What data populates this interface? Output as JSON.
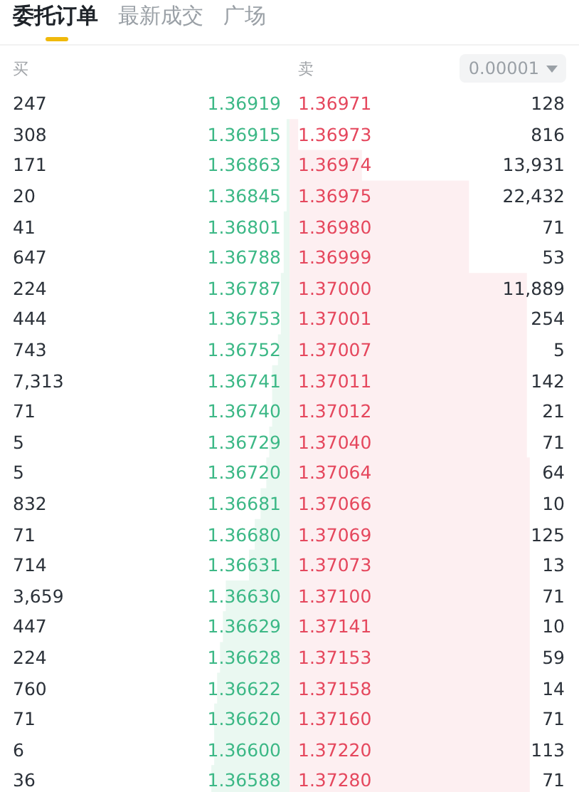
{
  "tabs": [
    {
      "label": "委托订单",
      "selected": true
    },
    {
      "label": "最新成交",
      "selected": false
    },
    {
      "label": "广场",
      "selected": false
    }
  ],
  "header": {
    "buy": "买",
    "sell": "卖",
    "precision": "0.00001"
  },
  "rows": [
    {
      "bid": {
        "qty": "247",
        "price": "1.36919"
      },
      "ask": {
        "price": "1.36971",
        "qty": "128"
      }
    },
    {
      "bid": {
        "qty": "308",
        "price": "1.36915"
      },
      "ask": {
        "price": "1.36973",
        "qty": "816"
      }
    },
    {
      "bid": {
        "qty": "171",
        "price": "1.36863"
      },
      "ask": {
        "price": "1.36974",
        "qty": "13,931"
      }
    },
    {
      "bid": {
        "qty": "20",
        "price": "1.36845"
      },
      "ask": {
        "price": "1.36975",
        "qty": "22,432"
      }
    },
    {
      "bid": {
        "qty": "41",
        "price": "1.36801"
      },
      "ask": {
        "price": "1.36980",
        "qty": "71"
      }
    },
    {
      "bid": {
        "qty": "647",
        "price": "1.36788"
      },
      "ask": {
        "price": "1.36999",
        "qty": "53"
      }
    },
    {
      "bid": {
        "qty": "224",
        "price": "1.36787"
      },
      "ask": {
        "price": "1.37000",
        "qty": "11,889"
      }
    },
    {
      "bid": {
        "qty": "444",
        "price": "1.36753"
      },
      "ask": {
        "price": "1.37001",
        "qty": "254"
      }
    },
    {
      "bid": {
        "qty": "743",
        "price": "1.36752"
      },
      "ask": {
        "price": "1.37007",
        "qty": "5"
      }
    },
    {
      "bid": {
        "qty": "7,313",
        "price": "1.36741"
      },
      "ask": {
        "price": "1.37011",
        "qty": "142"
      }
    },
    {
      "bid": {
        "qty": "71",
        "price": "1.36740"
      },
      "ask": {
        "price": "1.37012",
        "qty": "21"
      }
    },
    {
      "bid": {
        "qty": "5",
        "price": "1.36729"
      },
      "ask": {
        "price": "1.37040",
        "qty": "71"
      }
    },
    {
      "bid": {
        "qty": "5",
        "price": "1.36720"
      },
      "ask": {
        "price": "1.37064",
        "qty": "64"
      }
    },
    {
      "bid": {
        "qty": "832",
        "price": "1.36681"
      },
      "ask": {
        "price": "1.37066",
        "qty": "10"
      }
    },
    {
      "bid": {
        "qty": "71",
        "price": "1.36680"
      },
      "ask": {
        "price": "1.37069",
        "qty": "125"
      }
    },
    {
      "bid": {
        "qty": "714",
        "price": "1.36631"
      },
      "ask": {
        "price": "1.37073",
        "qty": "13"
      }
    },
    {
      "bid": {
        "qty": "3,659",
        "price": "1.36630"
      },
      "ask": {
        "price": "1.37100",
        "qty": "71"
      }
    },
    {
      "bid": {
        "qty": "447",
        "price": "1.36629"
      },
      "ask": {
        "price": "1.37141",
        "qty": "10"
      }
    },
    {
      "bid": {
        "qty": "224",
        "price": "1.36628"
      },
      "ask": {
        "price": "1.37153",
        "qty": "59"
      }
    },
    {
      "bid": {
        "qty": "760",
        "price": "1.36622"
      },
      "ask": {
        "price": "1.37158",
        "qty": "14"
      }
    },
    {
      "bid": {
        "qty": "71",
        "price": "1.36620"
      },
      "ask": {
        "price": "1.37160",
        "qty": "71"
      }
    },
    {
      "bid": {
        "qty": "6",
        "price": "1.36600"
      },
      "ask": {
        "price": "1.37220",
        "qty": "113"
      }
    },
    {
      "bid": {
        "qty": "36",
        "price": "1.36588"
      },
      "ask": {
        "price": "1.37280",
        "qty": "71"
      }
    }
  ]
}
